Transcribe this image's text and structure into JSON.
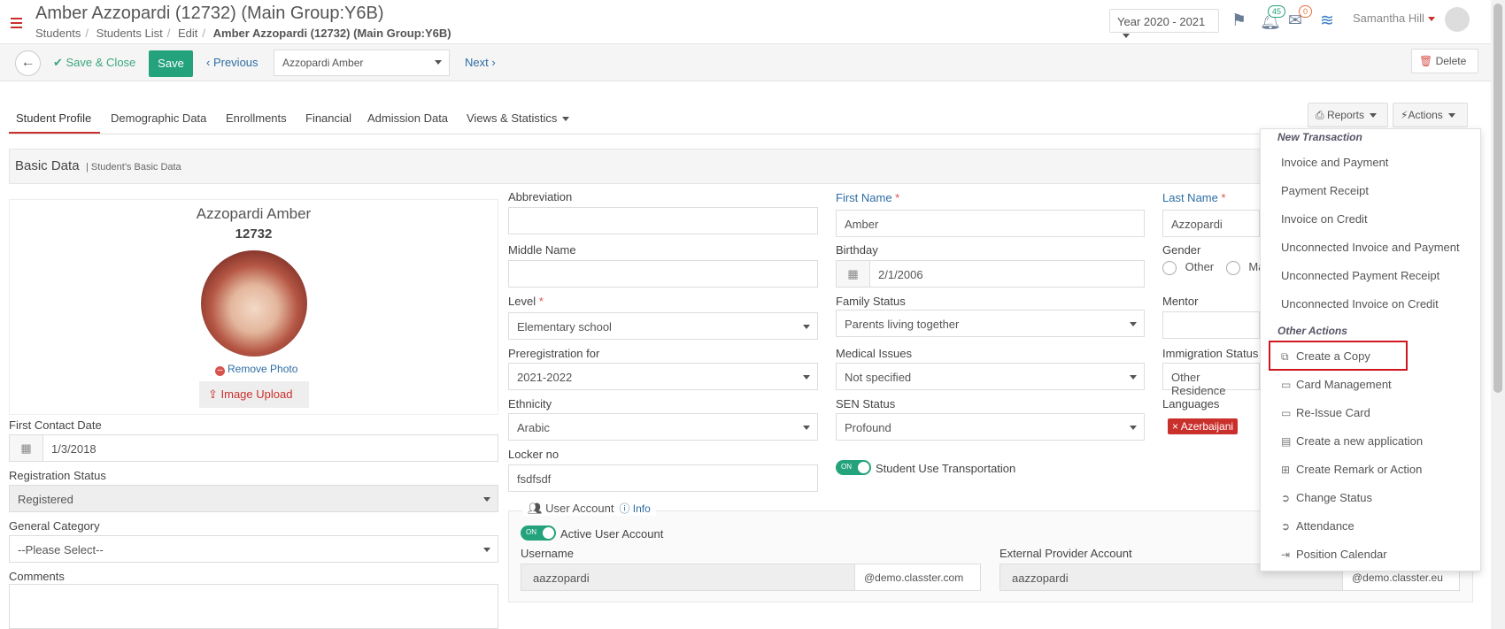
{
  "header": {
    "title": "Amber Azzopardi (12732) (Main Group:Y6B)",
    "breadcrumb": [
      "Students",
      "Students List",
      "Edit",
      "Amber Azzopardi (12732) (Main Group:Y6B)"
    ],
    "year": "Year 2020 - 2021",
    "notifications_count": "45",
    "messages_count": "0",
    "user": "Samantha Hill"
  },
  "toolbar": {
    "save_close": "Save & Close",
    "save": "Save",
    "previous": "Previous",
    "student_select": "Azzopardi Amber",
    "next": "Next",
    "delete": "Delete"
  },
  "tabs": [
    "Student Profile",
    "Demographic Data",
    "Enrollments",
    "Financial",
    "Admission Data",
    "Views & Statistics"
  ],
  "buttons": {
    "reports": "Reports",
    "actions": "Actions"
  },
  "section": {
    "title": "Basic Data",
    "subtitle": "| Student's Basic Data"
  },
  "profile": {
    "name": "Azzopardi Amber",
    "id": "12732",
    "remove_photo": "Remove Photo",
    "image_upload": "Image Upload"
  },
  "left_fields": {
    "first_contact_label": "First Contact Date",
    "first_contact_value": "1/3/2018",
    "registration_label": "Registration Status",
    "registration_value": "Registered",
    "category_label": "General Category",
    "category_value": "--Please Select--",
    "comments_label": "Comments"
  },
  "fields": {
    "abbreviation_label": "Abbreviation",
    "first_name_label": "First Name",
    "first_name_value": "Amber",
    "last_name_label": "Last Name",
    "last_name_value": "Azzopardi",
    "middle_name_label": "Middle Name",
    "birthday_label": "Birthday",
    "birthday_value": "2/1/2006",
    "gender_label": "Gender",
    "gender_other": "Other",
    "gender_male": "Ma",
    "level_label": "Level",
    "level_value": "Elementary school",
    "family_label": "Family Status",
    "family_value": "Parents living together",
    "mentor_label": "Mentor",
    "prereg_label": "Preregistration for",
    "prereg_value": "2021-2022",
    "medical_label": "Medical Issues",
    "medical_value": "Not specified",
    "immigration_label": "Immigration Status",
    "immigration_value": "Other Residence",
    "ethnicity_label": "Ethnicity",
    "ethnicity_value": "Arabic",
    "sen_label": "SEN Status",
    "sen_value": "Profound",
    "languages_label": "Languages",
    "language_tag": "Azerbaijani",
    "locker_label": "Locker no",
    "locker_value": "fsdfsdf",
    "transport_toggle": "ON",
    "transport_label": "Student Use Transportation"
  },
  "user_account": {
    "legend": "User Account",
    "info": "Info",
    "active_toggle": "ON",
    "active_label": "Active User Account",
    "username_label": "Username",
    "username_value": "aazzopardi",
    "username_domain": "@demo.classter.com",
    "external_label": "External Provider Account",
    "external_value": "aazzopardi",
    "external_domain": "@demo.classter.eu"
  },
  "actions_menu": {
    "header1": "New Transaction",
    "transactions": [
      "Invoice and Payment",
      "Payment Receipt",
      "Invoice on Credit",
      "Unconnected Invoice and Payment",
      "Unconnected Payment Receipt",
      "Unconnected Invoice on Credit"
    ],
    "header2": "Other Actions",
    "other": [
      "Create a Copy",
      "Card Management",
      "Re-Issue Card",
      "Create a new application",
      "Create Remark or Action",
      "Change Status",
      "Attendance",
      "Position Calendar"
    ]
  },
  "colors": {
    "accent": "#24a27b",
    "link": "#2e6da4",
    "danger": "#c9302c"
  }
}
